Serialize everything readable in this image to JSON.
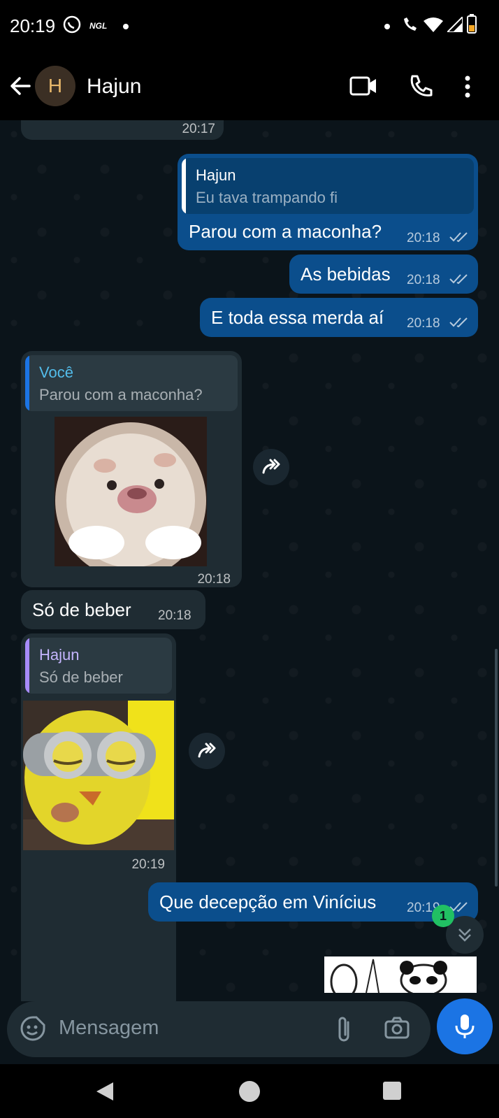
{
  "status_bar": {
    "time": "20:19",
    "ngl_label": "NGL"
  },
  "header": {
    "avatar_letter": "H",
    "contact_name": "Hajun"
  },
  "messages": [
    {
      "time": "20:17"
    },
    {
      "quote_author": "Hajun",
      "quote_text": "Eu tava trampando fi",
      "text": "Parou com a maconha?",
      "time": "20:18"
    },
    {
      "text": "As bebidas",
      "time": "20:18"
    },
    {
      "text": "E toda essa merda aí",
      "time": "20:18"
    },
    {
      "quote_author": "Você",
      "quote_text": "Parou com a maconha?",
      "time": "20:18"
    },
    {
      "text": "Só de beber",
      "time": "20:18"
    },
    {
      "quote_author": "Hajun",
      "quote_text": "Só de beber",
      "time": "20:19"
    },
    {
      "text": "Que decepção em Vinícius",
      "time": "20:19"
    }
  ],
  "unread_badge": "1",
  "input": {
    "placeholder": "Mensagem"
  },
  "colors": {
    "outgoing": "#0b4e8c",
    "incoming": "#1f2c33",
    "accent": "#1b74e4",
    "badge": "#21c063"
  }
}
